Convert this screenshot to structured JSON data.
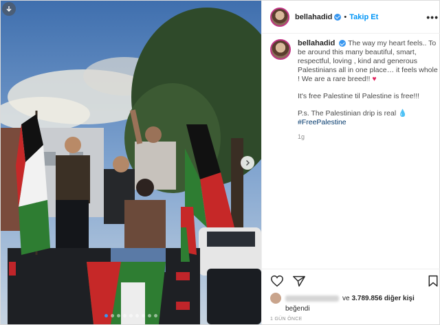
{
  "header": {
    "username": "bellahadid",
    "separator": "•",
    "follow_label": "Takip Et",
    "more_label": "•••"
  },
  "caption": {
    "username": "bellahadid",
    "para1": "The way my heart feels.. To be around this many beautiful, smart, respectful, loving , kind and generous Palestinians all in one place… it feels whole ! We are a rare breed!!",
    "heart": "♥",
    "para2": "It's free Palestine til Palestine is free!!!",
    "para3": "P.s. The Palestinian drip is real",
    "drop": "💧",
    "hashtag": "#FreePalestine",
    "age": "1g"
  },
  "likes": {
    "connector": "ve",
    "count": "3.789.856 diğer kişi",
    "liked_text": "beğendi"
  },
  "footer": {
    "timestamp": "1 GÜN ÖNCE"
  },
  "media": {
    "carousel_total": 9,
    "carousel_active": 0
  },
  "colors": {
    "accent": "#0095f6",
    "heart": "#e0245e",
    "verified": "#3897f0"
  }
}
